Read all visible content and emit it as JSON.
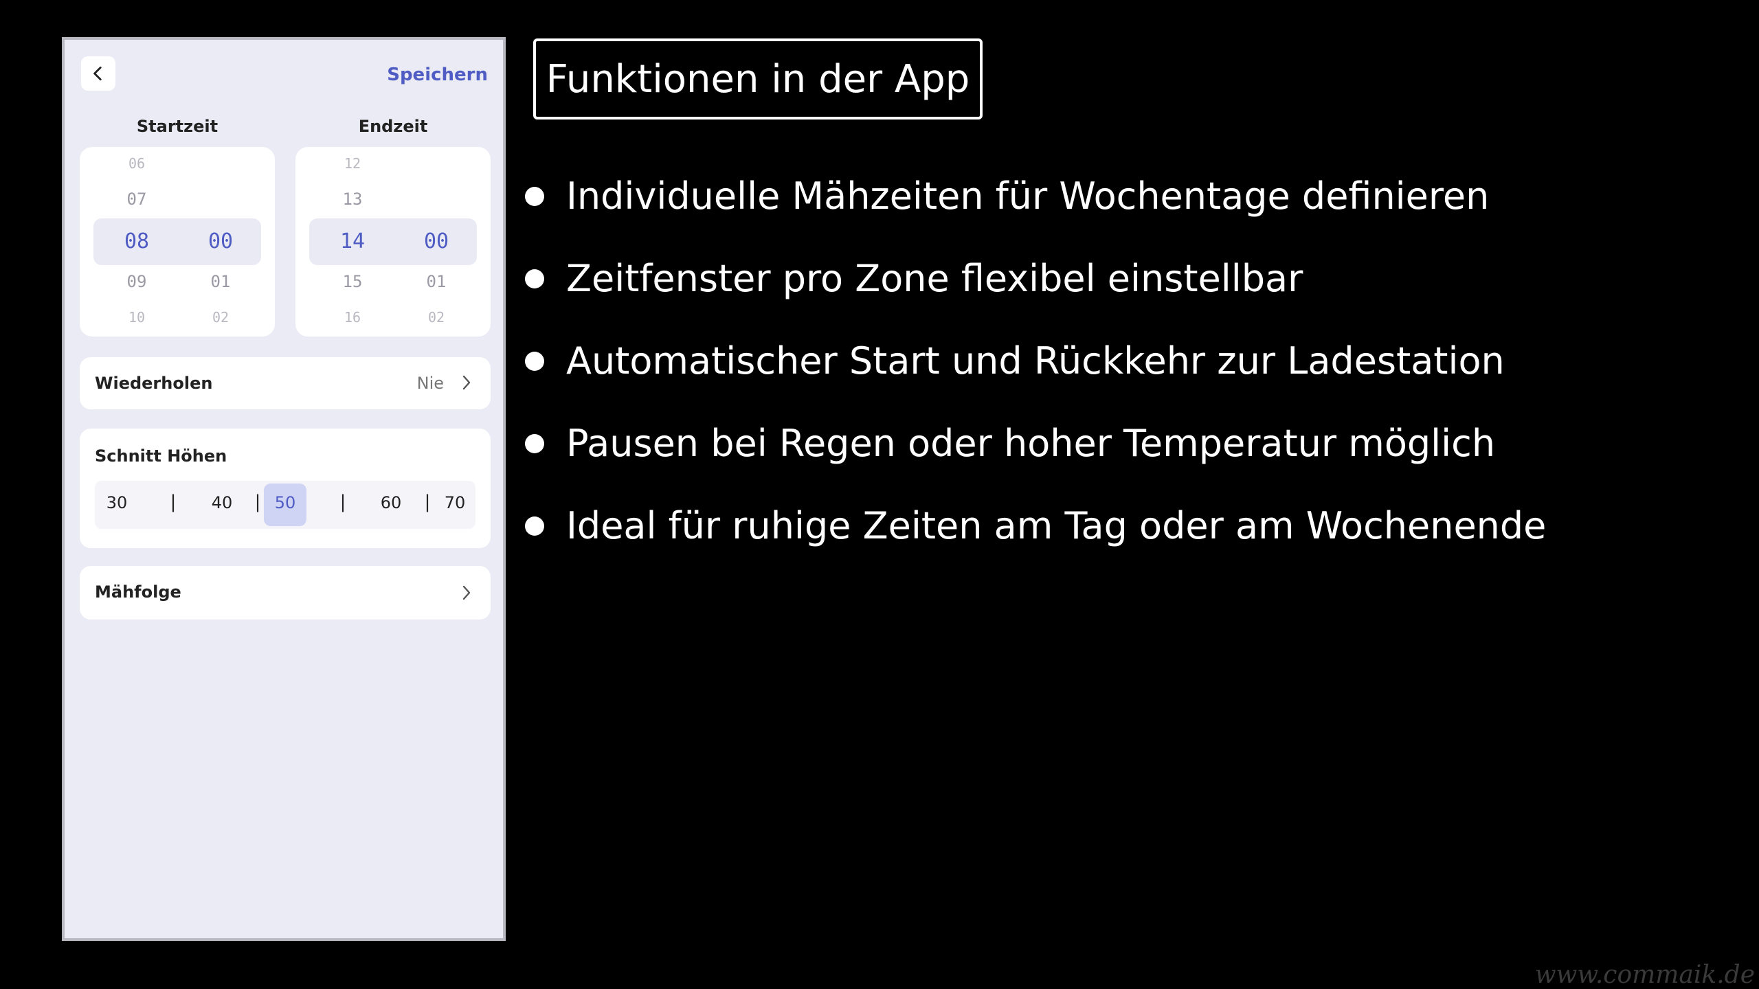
{
  "phone": {
    "save_label": "Speichern",
    "start_label": "Startzeit",
    "end_label": "Endzeit",
    "start_picker": {
      "hours": [
        "06",
        "07",
        "08",
        "09",
        "10"
      ],
      "minutes": [
        "00",
        "01",
        "02"
      ]
    },
    "end_picker": {
      "hours": [
        "12",
        "13",
        "14",
        "15",
        "16"
      ],
      "minutes": [
        "00",
        "01",
        "02"
      ]
    },
    "repeat_label": "Wiederholen",
    "repeat_value": "Nie",
    "cut_height_label": "Schnitt Höhen",
    "cut_heights": [
      "30",
      "40",
      "50",
      "60",
      "70"
    ],
    "cut_height_selected": "50",
    "mow_order_label": "Mähfolge"
  },
  "slide": {
    "title": "Funktionen in der App",
    "bullets": [
      "Individuelle Mähzeiten für Wochentage definieren",
      "Zeitfenster pro Zone flexibel einstellbar",
      "Automatischer Start und Rückkehr zur Ladestation",
      "Pausen bei Regen oder hoher Temperatur möglich",
      "Ideal für ruhige Zeiten am Tag oder am Wochenende"
    ]
  },
  "watermark": "www.commaik.de",
  "colors": {
    "accent": "#4f5cc4",
    "background": "#000000",
    "panel": "#ebebf5"
  }
}
